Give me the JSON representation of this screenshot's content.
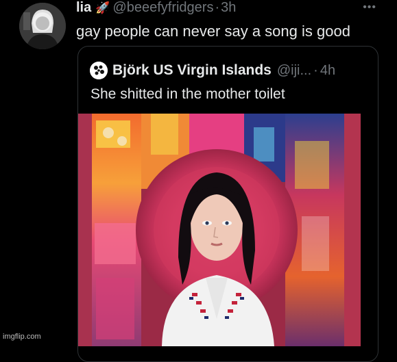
{
  "tweet": {
    "author_name": "lia",
    "author_emoji": "🚀",
    "handle": "@beeefyfridgers",
    "separator": "·",
    "time": "3h",
    "more_icon": "more-horizontal-icon",
    "text": "gay people can never say a song is good"
  },
  "quoted_tweet": {
    "author_name": "Björk US Virgin Islands",
    "handle": "@iji...",
    "separator": "·",
    "time": "4h",
    "text": "She shitted in the mother toilet",
    "image_icon": "album-cover-image"
  },
  "watermark": "imgflip.com",
  "colors": {
    "background": "#000000",
    "primary_text": "#e7e9ea",
    "secondary_text": "#71767b",
    "card_border": "#2f3336"
  }
}
